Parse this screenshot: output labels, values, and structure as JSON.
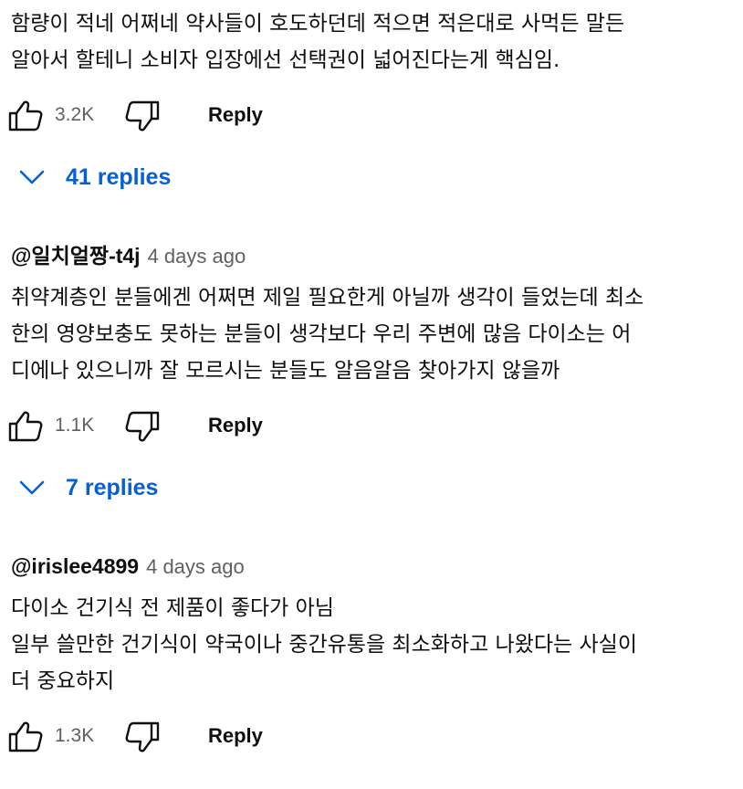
{
  "comments": [
    {
      "body_lines": [
        "함량이 적네 어쩌네 약사들이 호도하던데 적으면 적은대로 사먹든 말든",
        "알아서 할테니 소비자 입장에선 선택권이 넓어진다는게 핵심임."
      ],
      "likes": "3.2K",
      "reply_label": "Reply",
      "replies_label": "41 replies"
    },
    {
      "author": "@일치얼짱-t4j",
      "time": "4 days ago",
      "body_lines": [
        "취약계층인 분들에겐 어쩌면 제일 필요한게 아닐까 생각이 들었는데 최소",
        "한의 영양보충도 못하는 분들이 생각보다 우리 주변에 많음 다이소는 어",
        "디에나 있으니까 잘 모르시는 분들도 알음알음 찾아가지 않을까"
      ],
      "likes": "1.1K",
      "reply_label": "Reply",
      "replies_label": "7 replies"
    },
    {
      "author": "@irislee4899",
      "time": "4 days ago",
      "body_lines": [
        "다이소 건기식 전 제품이 좋다가 아님",
        "일부 쓸만한 건기식이 약국이나 중간유통을 최소화하고 나왔다는 사실이",
        "더 중요하지"
      ],
      "likes": "1.3K",
      "reply_label": "Reply"
    }
  ],
  "icons": {
    "like": "thumbs-up-outline-icon",
    "dislike": "thumbs-down-outline-icon",
    "expand": "chevron-down-icon"
  },
  "colors": {
    "text": "#0f0f0f",
    "secondary": "#606060",
    "link": "#065fd4",
    "background": "#ffffff"
  }
}
